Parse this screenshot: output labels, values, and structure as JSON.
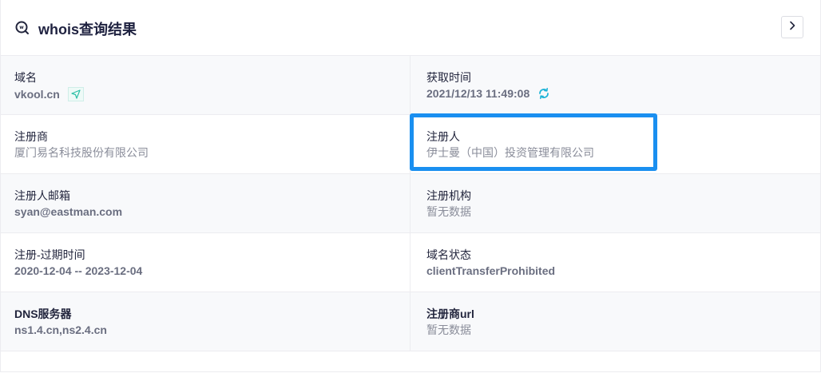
{
  "header": {
    "title": "whois查询结果",
    "icon": "whois-search-icon",
    "next_icon": "chevron-right-icon"
  },
  "colors": {
    "accent": "#1a8ff0",
    "teal": "#2bbfa5",
    "refresh": "#1fb4d8"
  },
  "fields": {
    "domain": {
      "label": "域名",
      "value": "vkool.cn"
    },
    "fetch_time": {
      "label": "获取时间",
      "value": "2021/12/13 11:49:08"
    },
    "registrar": {
      "label": "注册商",
      "value": "厦门易名科技股份有限公司"
    },
    "registrant": {
      "label": "注册人",
      "value": "伊士曼（中国）投资管理有限公司"
    },
    "registrant_email": {
      "label": "注册人邮箱",
      "value": "syan@eastman.com"
    },
    "registrant_org": {
      "label": "注册机构",
      "value": "暂无数据"
    },
    "reg_expire": {
      "label": "注册-过期时间",
      "value": "2020-12-04 -- 2023-12-04"
    },
    "domain_status": {
      "label": "域名状态",
      "value": "clientTransferProhibited"
    },
    "dns": {
      "label": "DNS服务器",
      "value": "ns1.4.cn,ns2.4.cn"
    },
    "registrar_url": {
      "label": "注册商url",
      "value": "暂无数据"
    }
  }
}
